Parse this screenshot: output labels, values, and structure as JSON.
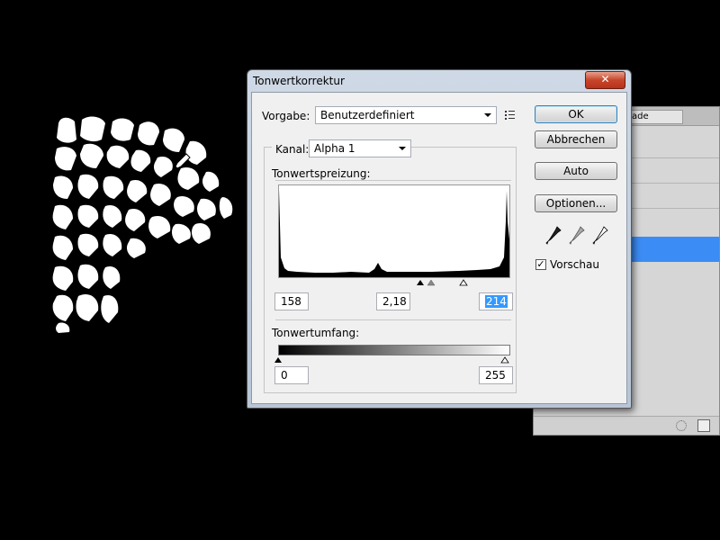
{
  "dialog": {
    "title": "Tonwertkorrektur",
    "close_glyph": "✕",
    "preset_label": "Vorgabe:",
    "preset_value": "Benutzerdefiniert",
    "channel_label": "Kanal:",
    "channel_value": "Alpha 1",
    "input_levels_label": "Tonwertspreizung:",
    "input_black": "158",
    "input_gamma": "2,18",
    "input_white": "214",
    "output_levels_label": "Tonwertumfang:",
    "output_black": "0",
    "output_white": "255",
    "buttons": {
      "ok": "OK",
      "cancel": "Abbrechen",
      "auto": "Auto",
      "options": "Optionen..."
    },
    "preview_label": "Vorschau",
    "preview_checked": "✓"
  },
  "background_panel": {
    "tab_label": "ade"
  },
  "icons": {
    "preset_menu": "preset-menu-icon",
    "black_eyedropper": "black-eyedropper-icon",
    "gray_eyedropper": "gray-eyedropper-icon",
    "white_eyedropper": "white-eyedropper-icon",
    "cursor": "eyedropper-cursor-icon"
  },
  "colors": {
    "selection": "#3399ff",
    "close_button": "#c7452a",
    "panel_selected_row": "#3b8cf4"
  }
}
